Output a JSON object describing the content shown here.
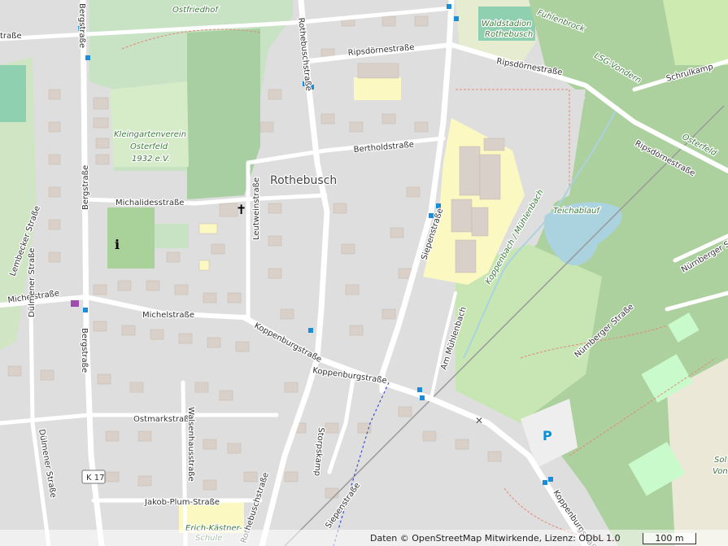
{
  "map": {
    "place": "Rothebusch",
    "streets": {
      "ripsdorne_1": "Ripsdörnestraße",
      "ripsdorne_2": "Ripsdörnestraße",
      "ripsdorne_3": "Ripsdörnestraße",
      "rothebuschstr": "Rothebuschstraße",
      "bertholdstr": "Bertholdstraße",
      "michalidesstr": "Michalidesstraße",
      "leutweinstr": "Leutweinstraße",
      "siepenstr": "Siepenstraße",
      "michelstr_1": "Michelstraße",
      "michelstr_2": "Michelstraße",
      "koppenburgstr_1": "Koppenburgstraße",
      "koppenburgstr_2": "Koppenburgstraße",
      "koppenburgstr_3": "Koppenburgstraße",
      "bergstr_1": "Bergstraße",
      "bergstr_2": "Bergstraße",
      "bergstr_3": "Bergstraße",
      "ostmarkstr": "Ostmarkstraße",
      "walsenhausstr": "Walsenhausstraße",
      "jakobplumstr": "Jakob-Plum-Straße",
      "storpskamp": "Storpskamp",
      "dulmener_1": "Dülmener Straße",
      "dulmener_2": "Dülmener Straße",
      "nurnberger_1": "Nürnberger Straße",
      "nurnberger_2": "Nürnberger Straße",
      "schrulkamp": "Schrulkamp",
      "am_muhlenbach": "Am Mühlenbach",
      "fuhlenbrock": "Fuhlenbrock",
      "siepen_left": "Siepenstraße",
      "rothebusch_bottom": "Rothebuschstraße",
      "lembecker": "Lembecker Straße",
      "left_top": "traße"
    },
    "areas": {
      "ostfriedhof": "Ostfriedhof",
      "kleingarten_1": "Kleingartenverein",
      "kleingarten_2": "Osterfeld",
      "kleingarten_3": "1932 e.V.",
      "waldstadion_1": "Waldstadion",
      "waldstadion_2": "Rothebusch",
      "lsg": "LSG-Vondern",
      "osterfeld": "Osterfeld",
      "teichablauf": "Teichablauf",
      "kopperbach": "Koppenbach / Mühlenbach",
      "schule_1": "Erich-Kästner-",
      "schule_2": "Schule",
      "sol_1": "Sol",
      "sol_2": "Von"
    },
    "road_ref": "K 17",
    "parking": "P"
  },
  "attribution": "Daten © OpenStreetMap Mitwirkende, Lizenz: ODbL 1.0",
  "scale_label": "100 m",
  "colors": {
    "background": "#dedede",
    "forest": "#add19e",
    "park": "#c8facc",
    "cemetery": "#aacbaf",
    "school": "#ffffe5",
    "water": "#aad3df",
    "building": "#d9d0c9",
    "road": "#ffffff",
    "transit_stop": "#1a8cd8"
  },
  "icons": [
    "church-cross-icon",
    "info-icon",
    "parking-icon",
    "bus-stop-icon",
    "railway-crossing-icon",
    "shop-icon"
  ]
}
